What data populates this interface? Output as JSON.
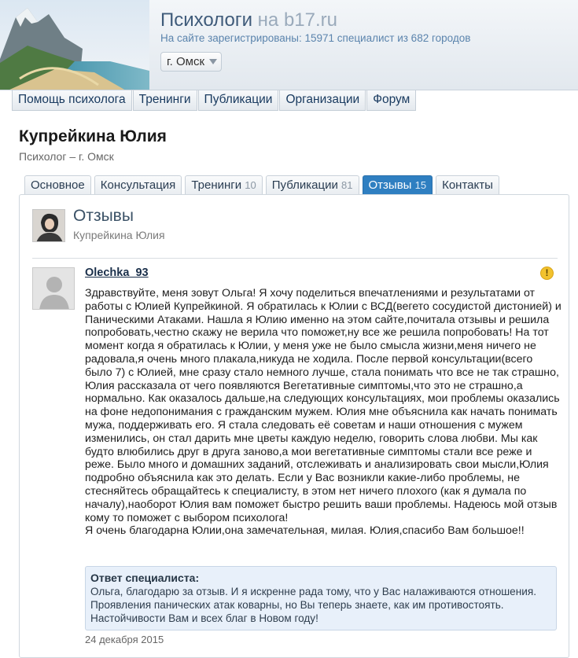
{
  "header": {
    "site_title": "Психологи",
    "site_domain": "на b17.ru",
    "stats": "На сайте зарегистрированы: 15971 специалист из 682 городов",
    "city": "г. Омск"
  },
  "nav": {
    "items": [
      "Помощь психолога",
      "Тренинги",
      "Публикации",
      "Организации",
      "Форум"
    ]
  },
  "profile": {
    "name": "Купрейкина Юлия",
    "subtitle": "Психолог – г. Омск"
  },
  "tabs": [
    {
      "label": "Основное",
      "count": ""
    },
    {
      "label": "Консультация",
      "count": ""
    },
    {
      "label": "Тренинги",
      "count": "10"
    },
    {
      "label": "Публикации",
      "count": "81"
    },
    {
      "label": "Отзывы",
      "count": "15",
      "active": true
    },
    {
      "label": "Контакты",
      "count": ""
    }
  ],
  "panel": {
    "title": "Отзывы",
    "author": "Купрейкина Юлия"
  },
  "review": {
    "user": "Olechka_93",
    "text": "Здравствуйте, меня зовут Ольга! Я хочу поделиться впечатлениями и результатами от работы с Юлией Купрейкиной. Я обратилась к Юлии с ВСД(вегето сосудистой дистонией) и Паническими Атаками. Нашла я Юлию именно на этом сайте,почитала отзывы и решила попробовать,честно скажу не верила что поможет,ну все же решила попробовать! На тот момент когда я обратилась к Юлии, у меня уже не было смысла жизни,меня ничего не радовала,я очень много плакала,никуда не ходила. После первой консультации(всего было 7) с Юлией, мне сразу стало немного лучше, стала понимать что все не так страшно, Юлия рассказала от чего появляются Вегетативные симптомы,что это не страшно,а нормально. Как оказалось дальше,на следующих консультациях, мои проблемы оказались на фоне недопонимания с гражданским мужем. Юлия мне объяснила как начать понимать мужа, поддерживать его. Я стала следовать её советам и наши отношения с мужем изменились, он стал дарить мне цветы каждую неделю, говорить слова любви. Мы как будто влюбились друг в друга заново,а мои вегетативные симптомы стали все реже и реже. Было много и домашних заданий, отслеживать и анализировать свои мысли,Юлия подробно объяснила как это делать. Если у Вас возникли какие-либо проблемы, не стесняйтесь обращайтесь к специалисту, в этом нет ничего плохого (как я думала по началу),наоборот Юлия вам поможет быстро решить ваши проблемы. Надеюсь мой отзыв кому то поможет с выбором психолога!",
    "text2": "Я очень благодарна Юлии,она замечательная, милая. Юлия,спасибо Вам большое!!",
    "reply_title": "Ответ специалиста:",
    "reply_text": "Ольга, благодарю за отзыв. И я искренне рада тому, что у Вас налаживаются отношения. Проявления панических атак коварны, но Вы теперь знаете, как им противостоять. Настойчивости Вам и всех благ в Новом году!",
    "date": "24 декабря 2015"
  },
  "colors": {
    "accent": "#2f7fc1",
    "link": "#1a3b60",
    "reply_bg": "#e8f0fa",
    "warning": "#f2c22e"
  },
  "icons": {
    "city_dropdown": "chevron-down-icon",
    "review_warning": "warning-icon"
  }
}
